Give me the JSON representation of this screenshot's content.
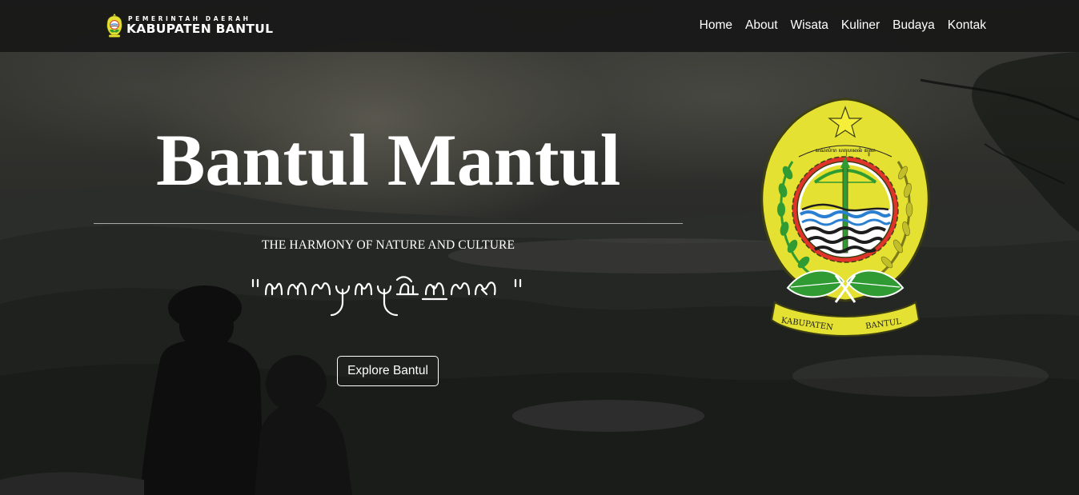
{
  "navbar": {
    "brand_top": "PEMERINTAH DAERAH",
    "brand_bottom": "KABUPATEN BANTUL",
    "links": [
      {
        "label": "Home"
      },
      {
        "label": "About"
      },
      {
        "label": "Wisata"
      },
      {
        "label": "Kuliner"
      },
      {
        "label": "Budaya"
      },
      {
        "label": "Kontak"
      }
    ]
  },
  "hero": {
    "title": "Bantul Mantul",
    "subtitle": "THE HARMONY OF NATURE AND CULTURE",
    "cta_label": "Explore Bantul"
  },
  "emblem": {
    "label_left": "KABUPATEN",
    "label_right": "BANTUL",
    "colors": {
      "shield": "#e4e133",
      "shield_edge": "#5a5a10",
      "ring_red": "#e0332a",
      "leaf_green": "#2f9b32",
      "water_blue": "#2a7fd0"
    }
  },
  "icons": {
    "brand": "bantul-crest-icon",
    "emblem": "bantul-emblem-icon"
  }
}
